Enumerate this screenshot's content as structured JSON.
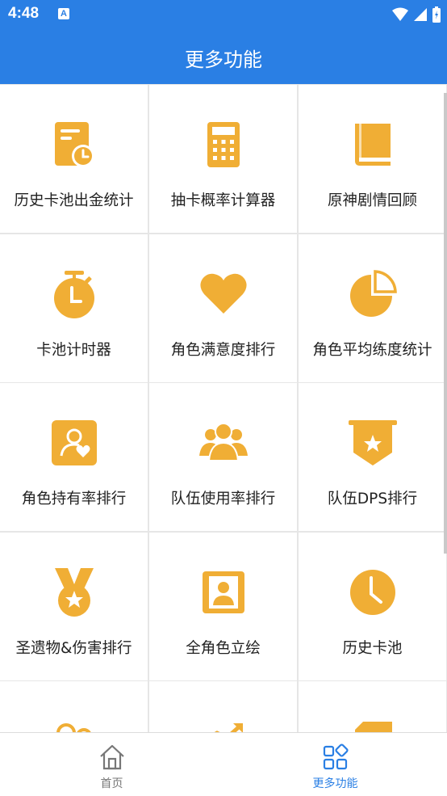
{
  "status_bar": {
    "time": "4:48",
    "notification_badge": "A"
  },
  "header": {
    "title": "更多功能"
  },
  "colors": {
    "primary": "#2a7fe4",
    "accent": "#f0ae35",
    "nav_inactive": "#777777"
  },
  "features": [
    {
      "label": "历史卡池出金统计",
      "icon": "document-clock-icon"
    },
    {
      "label": "抽卡概率计算器",
      "icon": "calculator-icon"
    },
    {
      "label": "原神剧情回顾",
      "icon": "book-icon"
    },
    {
      "label": "卡池计时器",
      "icon": "stopwatch-icon"
    },
    {
      "label": "角色满意度排行",
      "icon": "heart-icon"
    },
    {
      "label": "角色平均练度统计",
      "icon": "pie-chart-icon"
    },
    {
      "label": "角色持有率排行",
      "icon": "profile-heart-icon"
    },
    {
      "label": "队伍使用率排行",
      "icon": "group-icon"
    },
    {
      "label": "队伍DPS排行",
      "icon": "star-banner-icon"
    },
    {
      "label": "圣遗物&伤害排行",
      "icon": "medal-icon"
    },
    {
      "label": "全角色立绘",
      "icon": "portrait-icon"
    },
    {
      "label": "历史卡池",
      "icon": "clock-icon"
    },
    {
      "label": "",
      "icon": "users-icon"
    },
    {
      "label": "",
      "icon": "trend-icon"
    },
    {
      "label": "",
      "icon": "tag-icon"
    }
  ],
  "bottom_nav": {
    "items": [
      {
        "label": "首页",
        "icon": "home-icon",
        "active": false
      },
      {
        "label": "更多功能",
        "icon": "apps-icon",
        "active": true
      }
    ]
  }
}
